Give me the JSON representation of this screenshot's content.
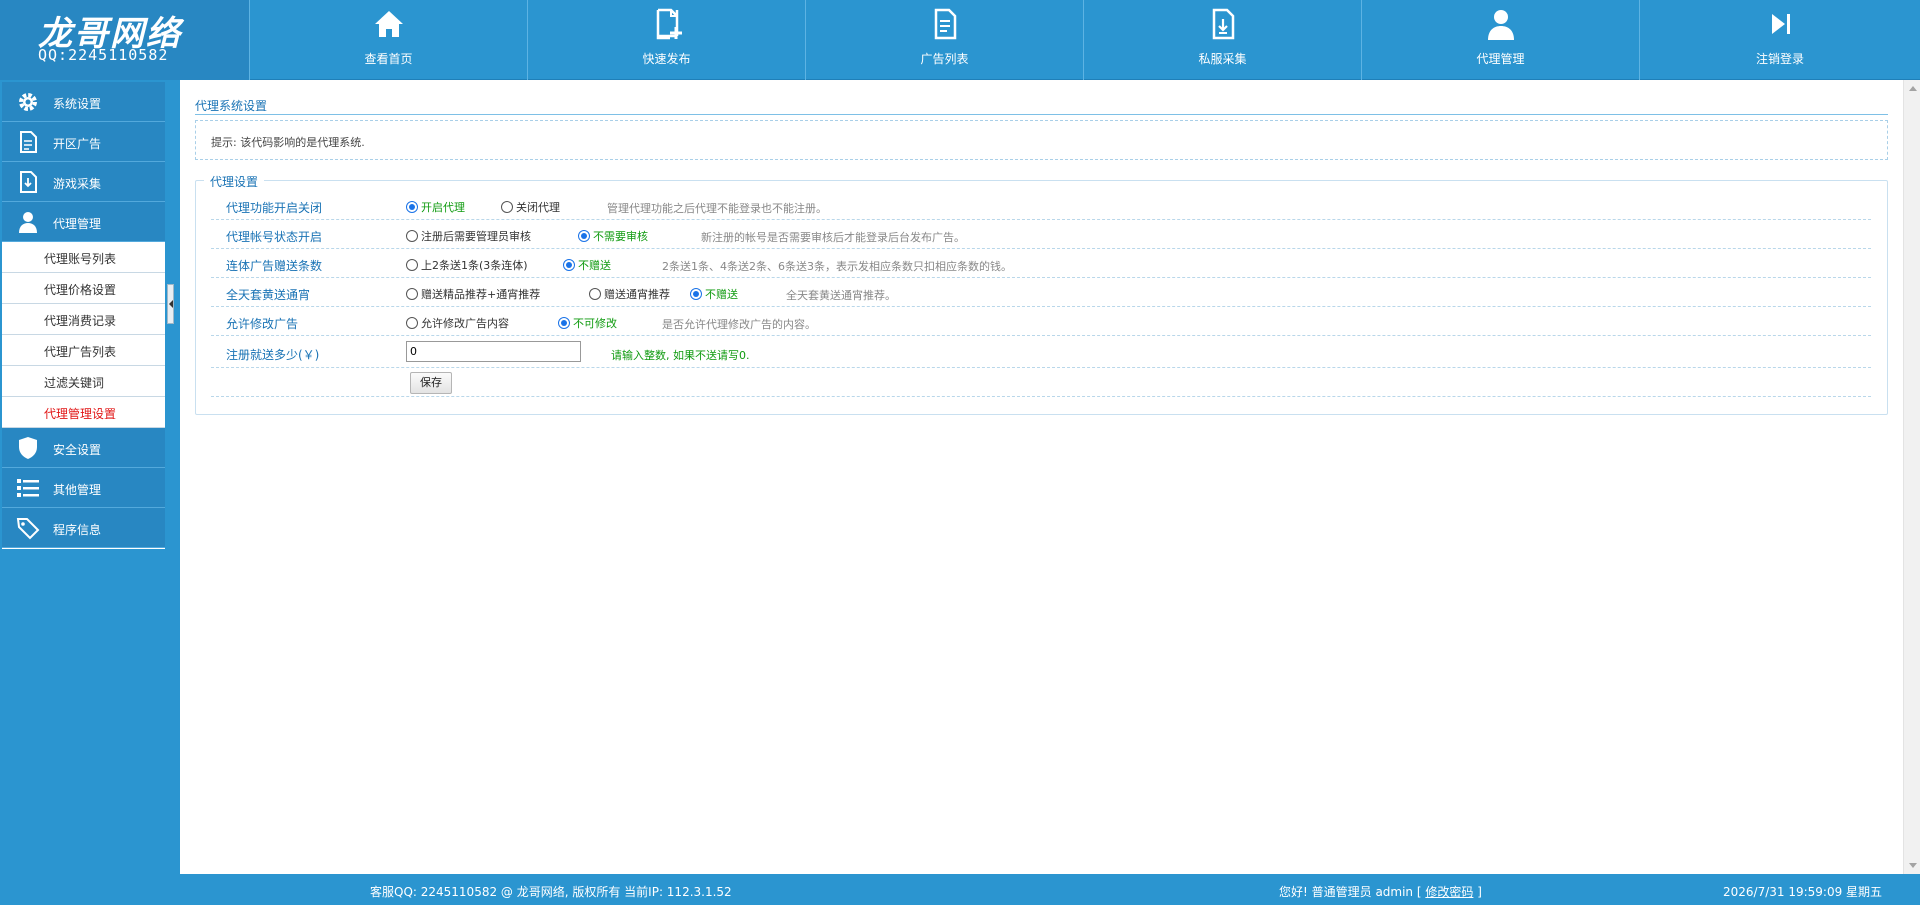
{
  "logo": {
    "title": "龙哥网络",
    "qq": "QQ:2245110582"
  },
  "nav": [
    {
      "label": "查看首页",
      "icon": "home-icon"
    },
    {
      "label": "快速发布",
      "icon": "add-document-icon"
    },
    {
      "label": "广告列表",
      "icon": "list-document-icon"
    },
    {
      "label": "私服采集",
      "icon": "download-document-icon"
    },
    {
      "label": "代理管理",
      "icon": "user-icon"
    },
    {
      "label": "注销登录",
      "icon": "logout-icon"
    }
  ],
  "sidebar": {
    "sections_top": [
      {
        "label": "系统设置",
        "icon": "gear-icon"
      },
      {
        "label": "开区广告",
        "icon": "document-icon"
      },
      {
        "label": "游戏采集",
        "icon": "download-document-icon"
      },
      {
        "label": "代理管理",
        "icon": "user-icon"
      }
    ],
    "sub_items": [
      {
        "label": "代理账号列表"
      },
      {
        "label": "代理价格设置"
      },
      {
        "label": "代理消费记录"
      },
      {
        "label": "代理广告列表"
      },
      {
        "label": "过滤关键词"
      },
      {
        "label": "代理管理设置"
      }
    ],
    "sections_bottom": [
      {
        "label": "安全设置",
        "icon": "shield-icon"
      },
      {
        "label": "其他管理",
        "icon": "list-icon"
      },
      {
        "label": "程序信息",
        "icon": "tag-icon"
      }
    ]
  },
  "main": {
    "title": "代理系统设置",
    "tip": "提示: 该代码影响的是代理系统.",
    "fieldset_legend": "代理设置",
    "rows": {
      "r1": {
        "label": "代理功能开启关闭",
        "opt1": "开启代理",
        "opt2": "关闭代理",
        "note": "管理代理功能之后代理不能登录也不能注册。"
      },
      "r2": {
        "label": "代理帐号状态开启",
        "opt1": "注册后需要管理员审核",
        "opt2": "不需要审核",
        "note": "新注册的帐号是否需要审核后才能登录后台发布广告。"
      },
      "r3": {
        "label": "连体广告赠送条数",
        "opt1": "上2条送1条(3条连体)",
        "opt2": "不赠送",
        "note": "2条送1条、4条送2条、6条送3条，表示发相应条数只扣相应条数的钱。"
      },
      "r4": {
        "label": "全天套黄送通宵",
        "opt1": "赠送精品推荐+通宵推荐",
        "opt2": "赠送通宵推荐",
        "opt3": "不赠送",
        "note": "全天套黄送通宵推荐。"
      },
      "r5": {
        "label": "允许修改广告",
        "opt1": "允许修改广告内容",
        "opt2": "不可修改",
        "note": "是否允许代理修改广告的内容。"
      },
      "r6": {
        "label": "注册就送多少(￥)",
        "value": "0",
        "note": "请输入整数, 如果不送请写0."
      },
      "save_label": "保存"
    }
  },
  "footer": {
    "left": "客服QQ:  2245110582   @ 龙哥网络, 版权所有  当前IP: 112.3.1.52",
    "greeting": "您好!  普通管理员 admin [",
    "change_password": "修改密码",
    "greeting_end": "]",
    "datetime": "2026/7/31 19:59:09 星期五"
  },
  "colors": {
    "primary": "#2b95d0",
    "dark": "#2887c2",
    "link": "#1a73b5",
    "active": "#e11515",
    "green": "#109b10"
  }
}
